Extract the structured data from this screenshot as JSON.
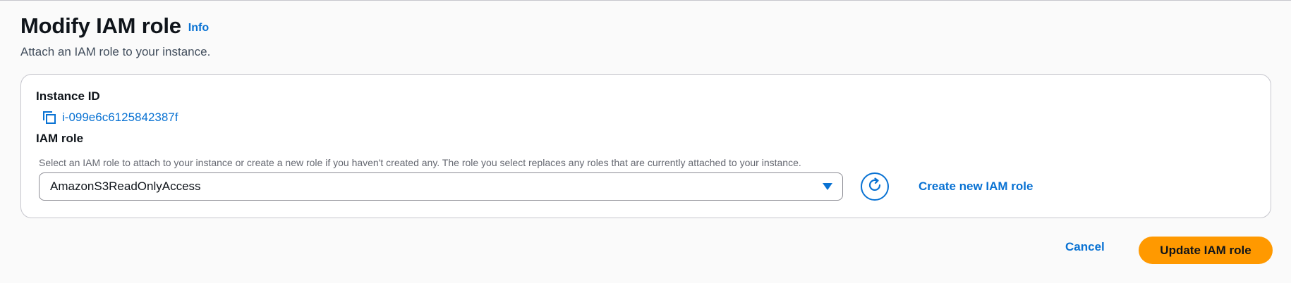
{
  "header": {
    "title": "Modify IAM role",
    "info_label": "Info",
    "description": "Attach an IAM role to your instance."
  },
  "instance": {
    "label": "Instance ID",
    "id": "i-099e6c6125842387f",
    "copy_icon": "copy-icon"
  },
  "iam_role": {
    "label": "IAM role",
    "description": "Select an IAM role to attach to your instance or create a new role if you haven't created any. The role you select replaces any roles that are currently attached to your instance.",
    "selected_value": "AmazonS3ReadOnlyAccess",
    "refresh_icon": "refresh-icon",
    "create_link": "Create new IAM role"
  },
  "actions": {
    "cancel_label": "Cancel",
    "submit_label": "Update IAM role"
  },
  "colors": {
    "accent": "#0972d3",
    "primary_button": "#ff9900",
    "border": "#c6c6cd"
  }
}
